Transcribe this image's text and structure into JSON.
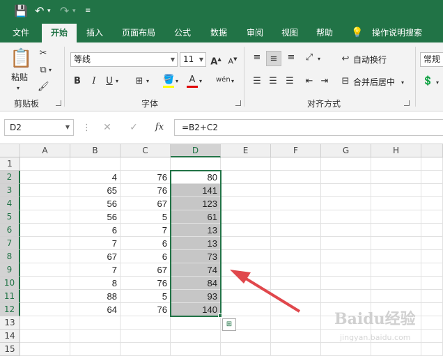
{
  "qat": {
    "undo_icon": "undo-icon",
    "redo_icon": "redo-icon"
  },
  "tabs": [
    {
      "label": "文件"
    },
    {
      "label": "开始"
    },
    {
      "label": "插入"
    },
    {
      "label": "页面布局"
    },
    {
      "label": "公式"
    },
    {
      "label": "数据"
    },
    {
      "label": "审阅"
    },
    {
      "label": "视图"
    },
    {
      "label": "帮助"
    },
    {
      "label": "操作说明搜索"
    }
  ],
  "ribbon": {
    "paste_label": "粘贴",
    "clipboard_label": "剪贴板",
    "font_name": "等线",
    "font_size": "11",
    "bold": "B",
    "italic": "I",
    "underline": "U",
    "font_group_label": "字体",
    "wrap_label": "自动换行",
    "merge_label": "合并后居中",
    "align_group_label": "对齐方式",
    "number_format": "常规"
  },
  "formula_bar": {
    "name_box": "D2",
    "fx": "fx",
    "formula": "=B2+C2"
  },
  "columns": [
    "A",
    "B",
    "C",
    "D",
    "E",
    "F",
    "G",
    "H"
  ],
  "rows": [
    "1",
    "2",
    "3",
    "4",
    "5",
    "6",
    "7",
    "8",
    "9",
    "10",
    "11",
    "12",
    "13",
    "14",
    "15"
  ],
  "cells": {
    "B": [
      "",
      "4",
      "65",
      "56",
      "56",
      "6",
      "7",
      "67",
      "7",
      "8",
      "88",
      "64",
      "",
      "",
      ""
    ],
    "C": [
      "",
      "76",
      "76",
      "67",
      "5",
      "7",
      "6",
      "6",
      "67",
      "76",
      "5",
      "76",
      "",
      "",
      ""
    ],
    "D": [
      "",
      "80",
      "141",
      "123",
      "61",
      "13",
      "13",
      "73",
      "74",
      "84",
      "93",
      "140",
      "",
      "",
      ""
    ]
  },
  "watermark": {
    "main": "Baidu经验",
    "sub": "jingyan.baidu.com"
  },
  "colors": {
    "accent": "#217346",
    "selection": "#c6c6c6",
    "arrow": "#e0474c"
  }
}
